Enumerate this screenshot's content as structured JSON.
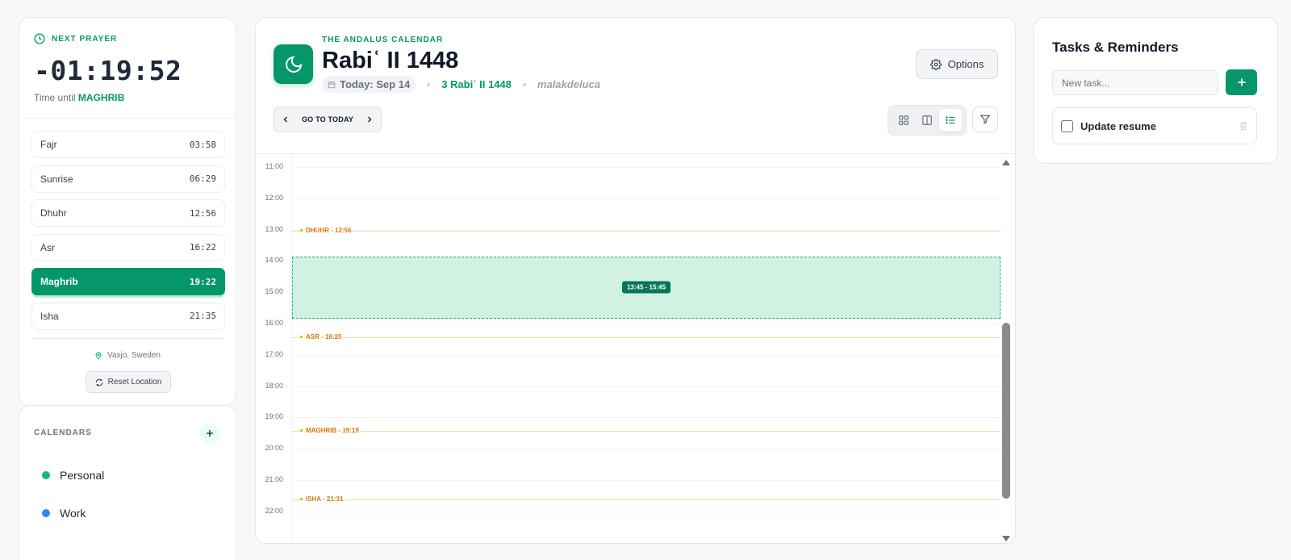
{
  "next_prayer": {
    "heading": "NEXT PRAYER",
    "countdown": "-01:19:52",
    "until_prefix": "Time until",
    "until_name": "MAGHRIB"
  },
  "prayers": [
    {
      "name": "Fajr",
      "time": "03:58"
    },
    {
      "name": "Sunrise",
      "time": "06:29"
    },
    {
      "name": "Dhuhr",
      "time": "12:56"
    },
    {
      "name": "Asr",
      "time": "16:22"
    },
    {
      "name": "Maghrib",
      "time": "19:22",
      "active": true
    },
    {
      "name": "Isha",
      "time": "21:35"
    }
  ],
  "location": {
    "label": "Vaxjo, Sweden",
    "reset_label": "Reset Location"
  },
  "calendars": {
    "title": "CALENDARS",
    "items": [
      {
        "label": "Personal",
        "color": "#10b981"
      },
      {
        "label": "Work",
        "color": "#3b82f6"
      }
    ]
  },
  "header": {
    "brand": "THE ANDALUS CALENDAR",
    "month": "Rabiʿ II 1448",
    "today": "Today: Sep 14",
    "hijri_date": "3 Rabiʿ II 1448",
    "username": "malakdeluca",
    "options_label": "Options",
    "go_today_label": "GO TO TODAY"
  },
  "timeline": {
    "hours": [
      "11:00",
      "12:00",
      "13:00",
      "14:00",
      "15:00",
      "16:00",
      "17:00",
      "18:00",
      "19:00",
      "20:00",
      "21:00",
      "22:00"
    ],
    "prayer_markers": [
      {
        "label": "DHUHR - 12:56",
        "time": "12:56"
      },
      {
        "label": "ASR - 16:20",
        "time": "16:20"
      },
      {
        "label": "MAGHRIB - 19:19",
        "time": "19:19"
      },
      {
        "label": "ISHA - 21:31",
        "time": "21:31"
      }
    ],
    "selection": {
      "label": "13:45 - 15:45",
      "start": "13:45",
      "end": "15:45"
    }
  },
  "tasks": {
    "title": "Tasks & Reminders",
    "placeholder": "New task...",
    "items": [
      {
        "label": "Update resume",
        "done": false
      }
    ]
  },
  "colors": {
    "accent": "#059669",
    "prayer_marker": "#d97706"
  }
}
